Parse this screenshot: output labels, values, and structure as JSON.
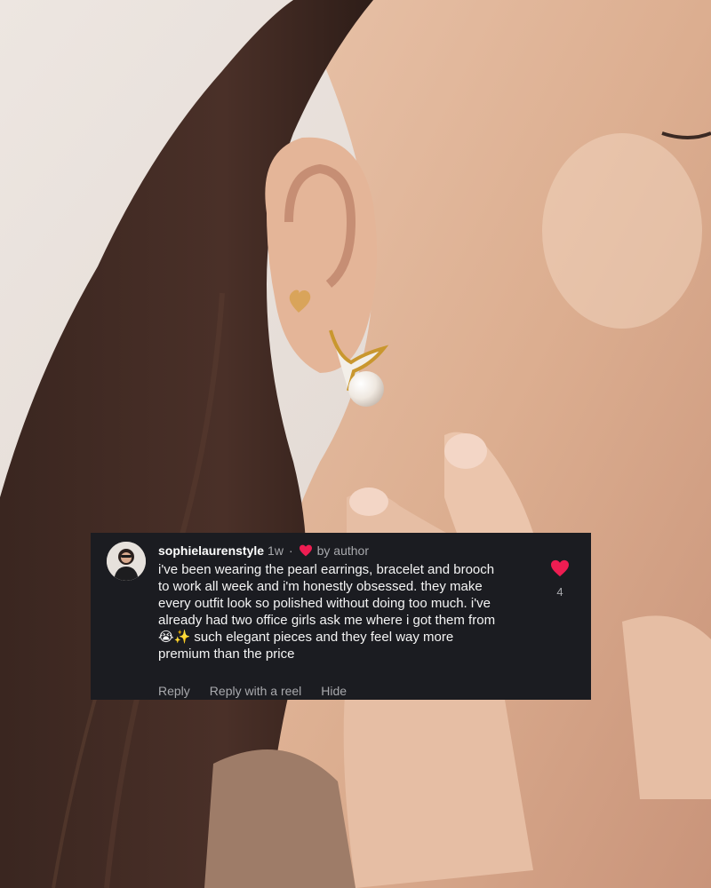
{
  "comment": {
    "username": "sophielaurenstyle",
    "time": "1w",
    "separator": "·",
    "author_badge": "by author",
    "text": "i've been wearing the pearl earrings, bracelet and brooch to work all week and i'm honestly obsessed. they make every outfit look so polished without doing too much. i've already had two office girls ask me where i got them from 😭✨ such elegant pieces and they feel way more premium than the price",
    "like_count": "4",
    "actions": {
      "reply": "Reply",
      "reply_reel": "Reply with a reel",
      "hide": "Hide"
    },
    "colors": {
      "background": "#1b1c21",
      "heart": "#ee1d52",
      "muted": "#a8a9ad"
    }
  },
  "icons": {
    "like": "heart-icon",
    "avatar": "profile-photo"
  }
}
